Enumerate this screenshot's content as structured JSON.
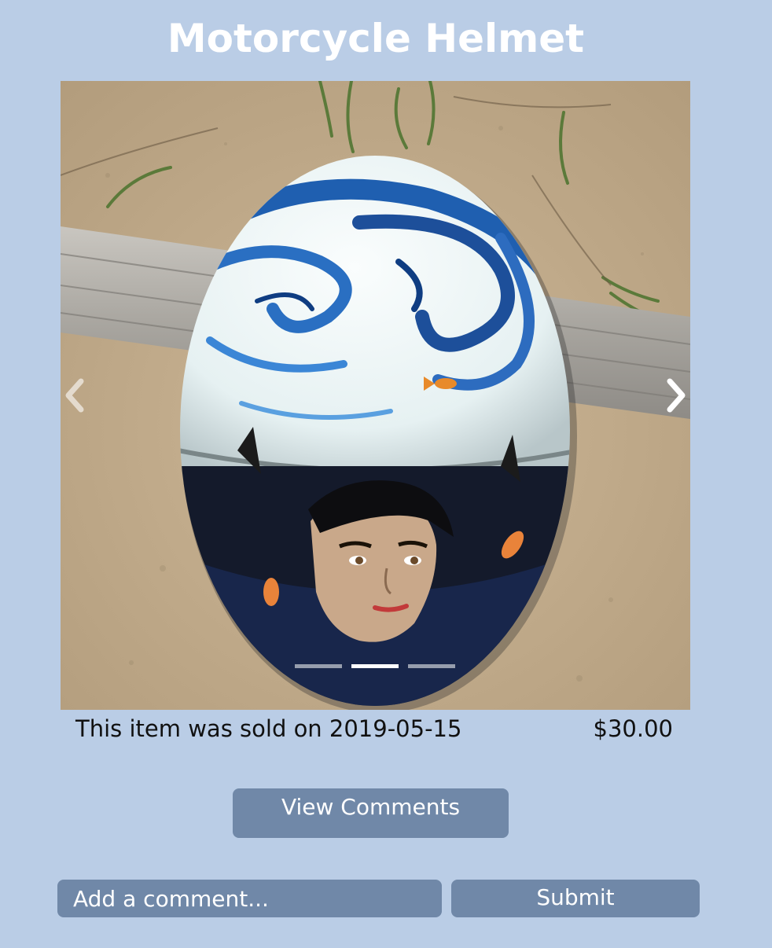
{
  "page": {
    "title": "Motorcycle Helmet"
  },
  "carousel": {
    "image": "painted-motorcycle-helmet-photo",
    "prev_icon": "chevron-left-icon",
    "next_icon": "chevron-right-icon",
    "slide_count": 3,
    "active_slide": 2
  },
  "item": {
    "sold_text": "This item was sold on 2019-05-15",
    "price": "$30.00"
  },
  "actions": {
    "view_comments_label": "View Comments",
    "comment_placeholder": "Add a comment...",
    "submit_label": "Submit"
  },
  "colors": {
    "background": "#bacde6",
    "button": "#7088a8",
    "title": "#ffffff"
  }
}
